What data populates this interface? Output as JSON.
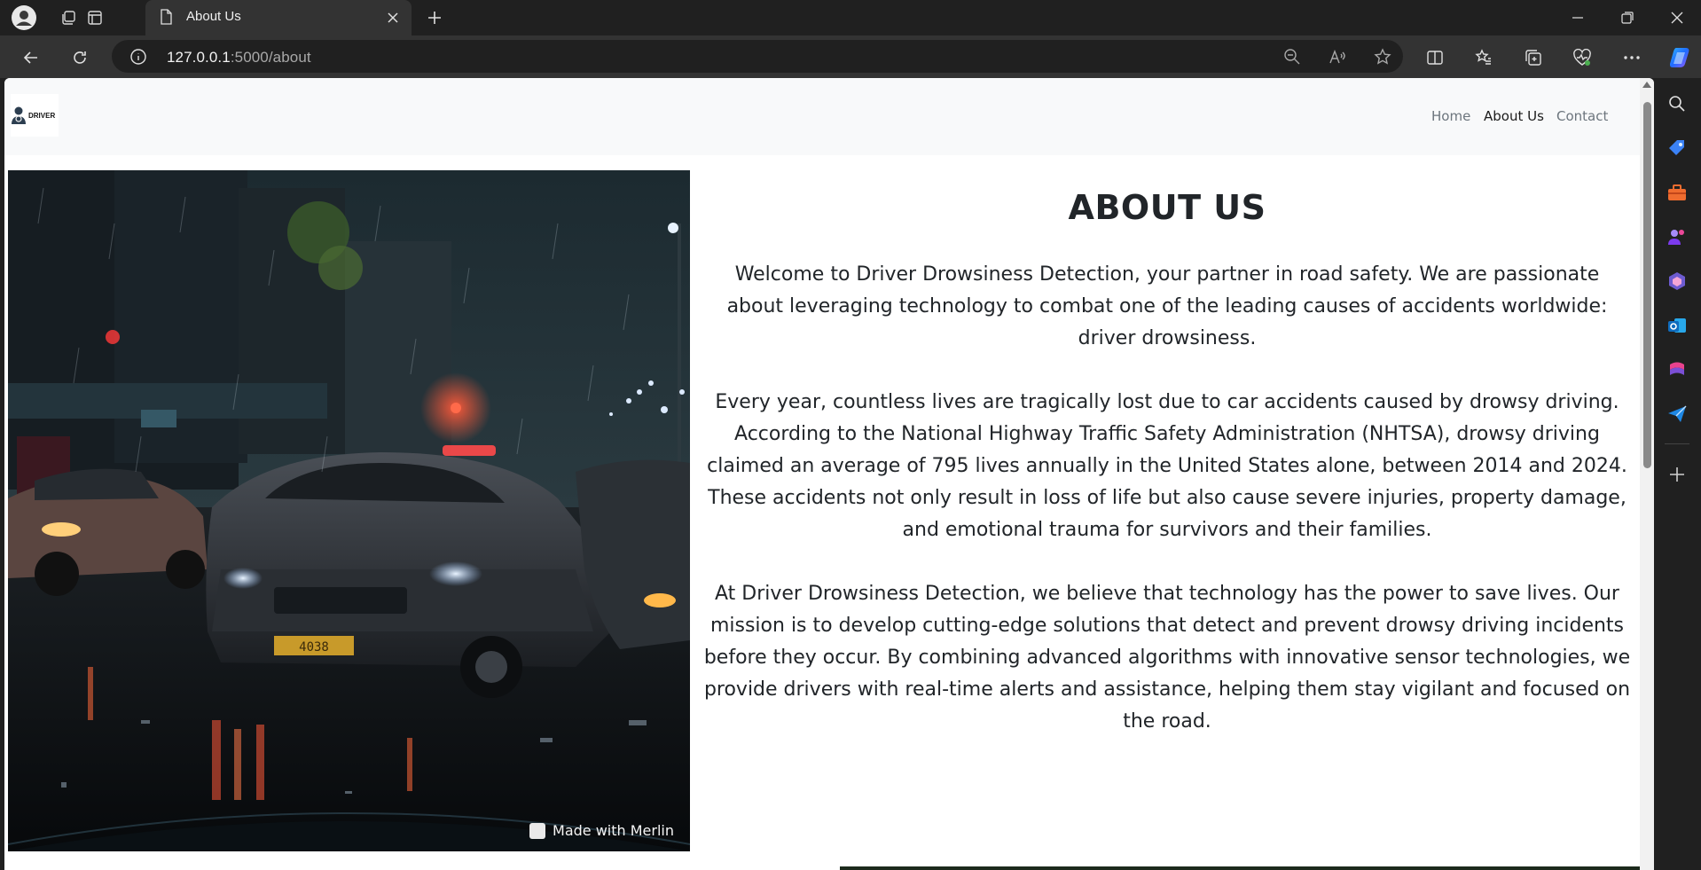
{
  "browser": {
    "tab_title": "About Us",
    "url_host": "127.0.0.1",
    "url_rest": ":5000/about"
  },
  "site": {
    "logo_text": "DRIVER",
    "nav": [
      {
        "label": "Home",
        "active": false
      },
      {
        "label": "About Us",
        "active": true
      },
      {
        "label": "Contact",
        "active": false
      }
    ]
  },
  "about": {
    "heading": "ABOUT US",
    "paragraphs": [
      "Welcome to Driver Drowsiness Detection, your partner in road safety. We are passionate about leveraging technology to combat one of the leading causes of accidents worldwide: driver drowsiness.",
      "Every year, countless lives are tragically lost due to car accidents caused by drowsy driving. According to the National Highway Traffic Safety Administration (NHTSA), drowsy driving claimed an average of 795 lives annually in the United States alone, between 2014 and 2024. These accidents not only result in loss of life but also cause severe injuries, property damage, and emotional trauma for survivors and their families.",
      "At Driver Drowsiness Detection, we believe that technology has the power to save lives. Our mission is to develop cutting-edge solutions that detect and prevent drowsy driving incidents before they occur. By combining advanced algorithms with innovative sensor technologies, we provide drivers with real-time alerts and assistance, helping them stay vigilant and focused on the road."
    ]
  },
  "image": {
    "watermark": "Made with Merlin",
    "plate_text": "4038"
  },
  "colors": {
    "accent": "#1b1b1b",
    "muted": "#6c757d"
  }
}
